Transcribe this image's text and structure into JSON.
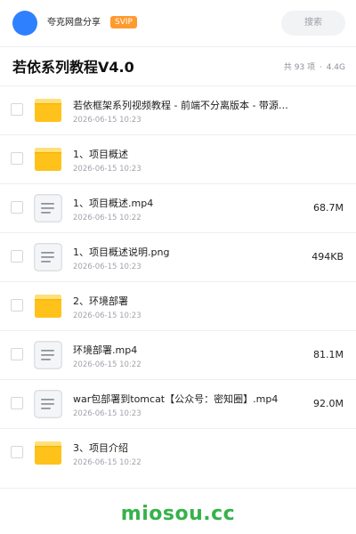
{
  "header": {
    "share_name": "夸克网盘分享",
    "badge": "SVIP",
    "search_placeholder": "搜索"
  },
  "folder": {
    "title": "若依系列教程V4.0",
    "count": "共 93 项",
    "separator": "·",
    "total_size": "4.4G"
  },
  "items": [
    {
      "icon": "folder-icon",
      "name": "若依框架系列视频教程 - 前端不分离版本 - 带源…",
      "date": "2026-06-15 10:23",
      "size": ""
    },
    {
      "icon": "folder-icon",
      "name": "1、项目概述",
      "date": "2026-06-15 10:23",
      "size": ""
    },
    {
      "icon": "file-icon",
      "name": "1、项目概述.mp4",
      "date": "2026-06-15 10:22",
      "size": "68.7M"
    },
    {
      "icon": "file-icon",
      "name": "1、项目概述说明.png",
      "date": "2026-06-15 10:23",
      "size": "494KB"
    },
    {
      "icon": "folder-icon",
      "name": "2、环境部署",
      "date": "2026-06-15 10:23",
      "size": ""
    },
    {
      "icon": "file-icon",
      "name": "环境部署.mp4",
      "date": "2026-06-15 10:22",
      "size": "81.1M"
    },
    {
      "icon": "file-icon",
      "name": "war包部署到tomcat【公众号：密知圈】.mp4",
      "date": "2026-06-15 10:23",
      "size": "92.0M"
    },
    {
      "icon": "folder-icon",
      "name": "3、项目介绍",
      "date": "2026-06-15 10:22",
      "size": ""
    }
  ],
  "footer": {
    "brand": "miosou.cc"
  },
  "colors": {
    "accent": "#2f80ff",
    "badge": "#ff9a2e",
    "folder": "#ffc21a",
    "brand": "#35b24a"
  }
}
